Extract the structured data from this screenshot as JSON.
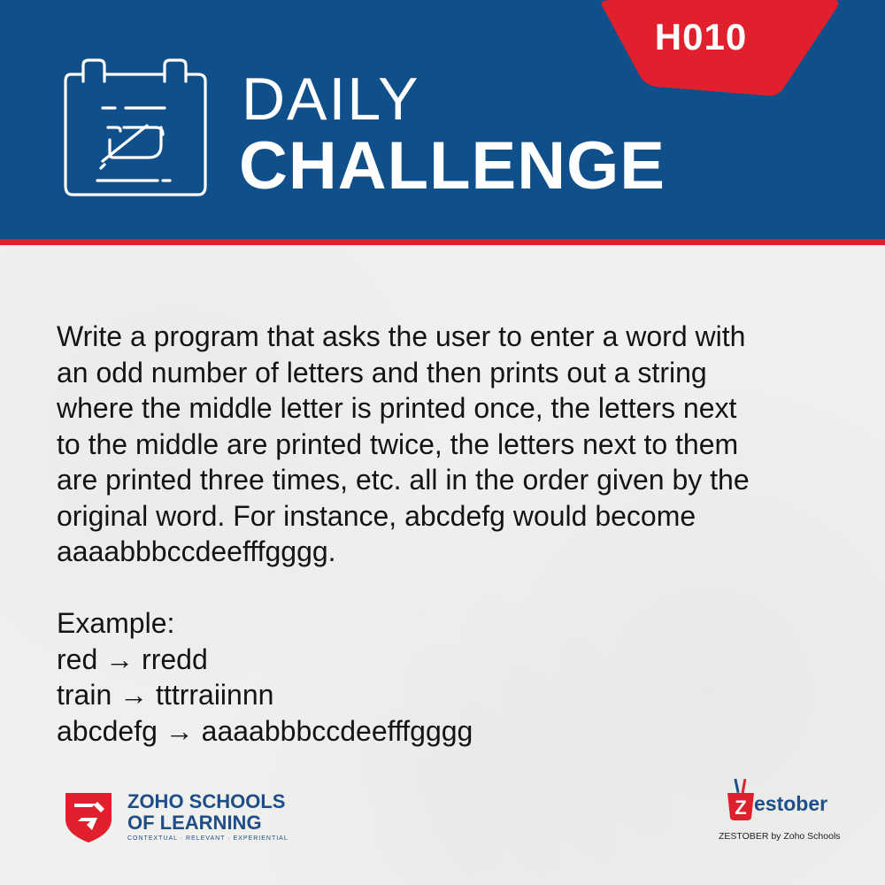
{
  "header": {
    "code": "H010",
    "title_line1": "DAILY",
    "title_line2": "CHALLENGE",
    "icon": "calendar-edit-icon",
    "colors": {
      "header_blue": "#0f4f8a",
      "accent_red": "#e0202d"
    }
  },
  "problem": {
    "lines": [
      "Write a program that asks the user to enter a word with",
      "an odd number of letters and then prints out a string",
      "where the middle letter is printed once, the letters next",
      "to the middle are printed twice, the letters next to them",
      "are printed three times, etc. all in the order given by the",
      "original word. For instance, abcdefg would become",
      "aaaabbbccdeefffgggg."
    ]
  },
  "example": {
    "label": "Example:",
    "items": [
      "red → rredd",
      "train → tttrraiinnn",
      "abcdefg → aaaabbbccdeefffgggg"
    ]
  },
  "footer": {
    "zsl": {
      "name_line1": "ZOHO SCHOOLS",
      "name_line2": "OF LEARNING",
      "tagline": "CONTEXTUAL · RELEVANT · EXPERIENTIAL",
      "icon": "zoho-schools-shield-icon"
    },
    "zestober": {
      "logo_letter": "Z",
      "wordmark": "estober",
      "caption": "ZESTOBER by Zoho Schools",
      "icon": "zestober-pen-cup-icon"
    }
  }
}
